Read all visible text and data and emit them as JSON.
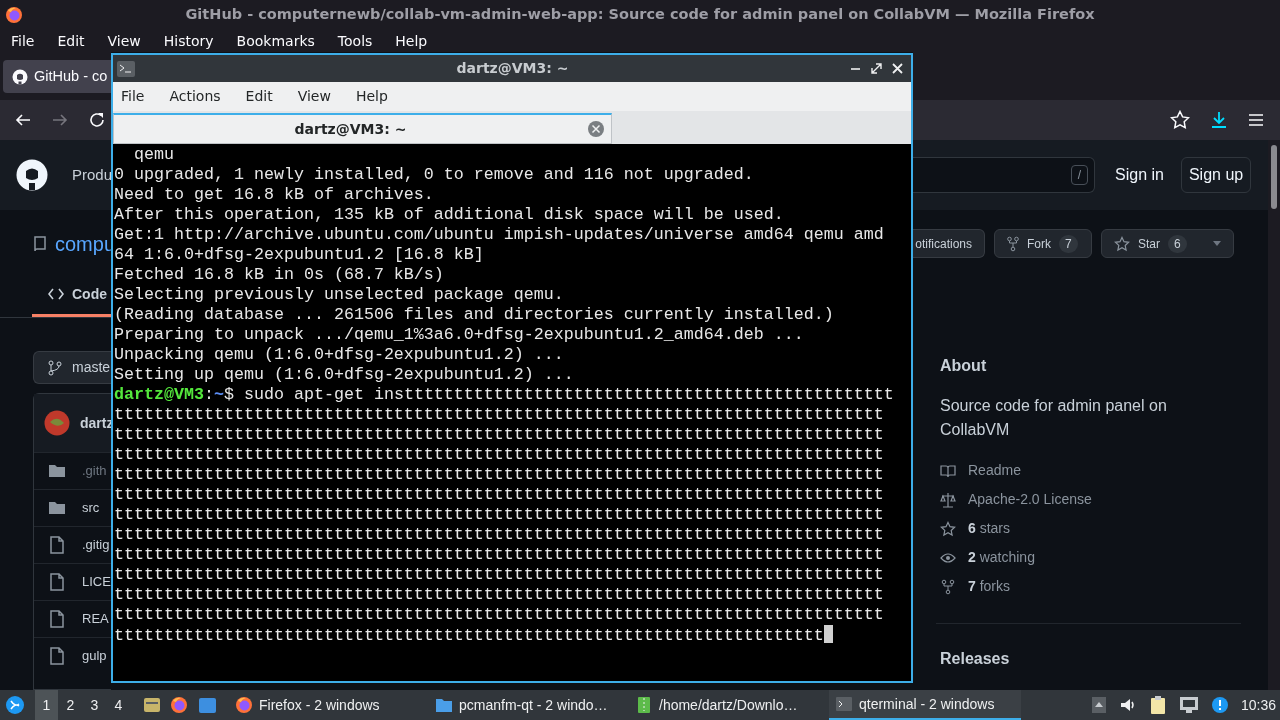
{
  "browser": {
    "title": "GitHub - computernewb/collab-vm-admin-web-app: Source code for admin panel on CollabVM — Mozilla Firefox",
    "menu": [
      "File",
      "Edit",
      "View",
      "History",
      "Bookmarks",
      "Tools",
      "Help"
    ],
    "tab": {
      "title": "GitHub - co",
      "selected": true
    }
  },
  "github": {
    "header": {
      "nav_item": "Produ",
      "search_key": "/",
      "sign_in": "Sign in",
      "sign_up": "Sign up"
    },
    "repo": {
      "name": "compu",
      "notifications": "otifications",
      "fork_label": "Fork",
      "fork_count": "7",
      "star_label": "Star",
      "star_count": "6"
    },
    "tabs": [
      {
        "label": "Code",
        "selected": true
      }
    ],
    "branch": "maste",
    "commit_author": "dartz",
    "files": [
      {
        "name": ".gith",
        "kind": "folder",
        "dimmed": true
      },
      {
        "name": "src",
        "kind": "folder",
        "dimmed": false
      },
      {
        "name": ".gitig",
        "kind": "file",
        "dimmed": false
      },
      {
        "name": "LICE",
        "kind": "file",
        "dimmed": false
      },
      {
        "name": "REA",
        "kind": "file",
        "dimmed": false
      },
      {
        "name": "gulp",
        "kind": "file",
        "dimmed": false
      }
    ],
    "about": {
      "heading": "About",
      "description": "Source code for admin panel on CollabVM",
      "links": [
        {
          "kind": "book",
          "text": "Readme"
        },
        {
          "kind": "scale",
          "text": "Apache-2.0 License"
        },
        {
          "kind": "star",
          "text": "**6** stars"
        },
        {
          "kind": "eye",
          "text": "**2** watching"
        },
        {
          "kind": "fork",
          "text": "**7** forks"
        }
      ]
    },
    "releases_heading": "Releases"
  },
  "terminal": {
    "title": "dartz@VM3: ~",
    "menu": [
      "File",
      "Actions",
      "Edit",
      "View",
      "Help"
    ],
    "tabs": [
      {
        "label": "dartz@VM3: ~",
        "selected": true
      }
    ],
    "lines": [
      {
        "kind": "output",
        "text": "  qemu"
      },
      {
        "kind": "output",
        "text": "0 upgraded, 1 newly installed, 0 to remove and 116 not upgraded."
      },
      {
        "kind": "output",
        "text": "Need to get 16.8 kB of archives."
      },
      {
        "kind": "output",
        "text": "After this operation, 135 kB of additional disk space will be used."
      },
      {
        "kind": "output",
        "text": "Get:1 http://archive.ubuntu.com/ubuntu impish-updates/universe amd64 qemu amd"
      },
      {
        "kind": "output",
        "text": "64 1:6.0+dfsg-2expubuntu1.2 [16.8 kB]"
      },
      {
        "kind": "output",
        "text": "Fetched 16.8 kB in 0s (68.7 kB/s)"
      },
      {
        "kind": "output",
        "text": "Selecting previously unselected package qemu."
      },
      {
        "kind": "output",
        "text": "(Reading database ... 261506 files and directories currently installed.)"
      },
      {
        "kind": "output",
        "text": "Preparing to unpack .../qemu_1%3a6.0+dfsg-2expubuntu1.2_amd64.deb ..."
      },
      {
        "kind": "output",
        "text": "Unpacking qemu (1:6.0+dfsg-2expubuntu1.2) ..."
      },
      {
        "kind": "output",
        "text": "Setting up qemu (1:6.0+dfsg-2expubuntu1.2) ..."
      },
      {
        "kind": "prompt",
        "user": "dartz@VM3",
        "sep": ":",
        "path": "~",
        "text": "$ sudo apt-get insttttttttttttttttttttttttttttttttttttttttttttttttt"
      },
      {
        "kind": "output",
        "text": "ttttttttttttttttttttttttttttttttttttttttttttttttttttttttttttttttttttttttttttt"
      },
      {
        "kind": "output",
        "text": "ttttttttttttttttttttttttttttttttttttttttttttttttttttttttttttttttttttttttttttt"
      },
      {
        "kind": "output",
        "text": "ttttttttttttttttttttttttttttttttttttttttttttttttttttttttttttttttttttttttttttt"
      },
      {
        "kind": "output",
        "text": "ttttttttttttttttttttttttttttttttttttttttttttttttttttttttttttttttttttttttttttt"
      },
      {
        "kind": "output",
        "text": "ttttttttttttttttttttttttttttttttttttttttttttttttttttttttttttttttttttttttttttt"
      },
      {
        "kind": "output",
        "text": "ttttttttttttttttttttttttttttttttttttttttttttttttttttttttttttttttttttttttttttt"
      },
      {
        "kind": "output",
        "text": "ttttttttttttttttttttttttttttttttttttttttttttttttttttttttttttttttttttttttttttt"
      },
      {
        "kind": "output",
        "text": "ttttttttttttttttttttttttttttttttttttttttttttttttttttttttttttttttttttttttttttt"
      },
      {
        "kind": "output",
        "text": "ttttttttttttttttttttttttttttttttttttttttttttttttttttttttttttttttttttttttttttt"
      },
      {
        "kind": "output",
        "text": "ttttttttttttttttttttttttttttttttttttttttttttttttttttttttttttttttttttttttttttt"
      },
      {
        "kind": "output",
        "text": "ttttttttttttttttttttttttttttttttttttttttttttttttttttttttttttttttttttttttttttt"
      },
      {
        "kind": "output",
        "text": "ttttttttttttttttttttttttttttttttttttttttttttttttttttttttttttttttttttttt",
        "cursor": true
      }
    ]
  },
  "taskbar": {
    "desktops": [
      {
        "label": "1",
        "selected": true
      },
      {
        "label": "2",
        "selected": false
      },
      {
        "label": "3",
        "selected": false
      },
      {
        "label": "4",
        "selected": false
      }
    ],
    "tasks": [
      {
        "label": "Firefox - 2 windows",
        "kind": "firefox",
        "selected": false
      },
      {
        "label": "pcmanfm-qt - 2 windo…",
        "kind": "folder",
        "selected": false
      },
      {
        "label": "/home/dartz/Downlo…",
        "kind": "archive",
        "selected": false
      },
      {
        "label": "qterminal - 2 windows",
        "kind": "terminal",
        "selected": true
      }
    ],
    "clock": "10:36"
  }
}
